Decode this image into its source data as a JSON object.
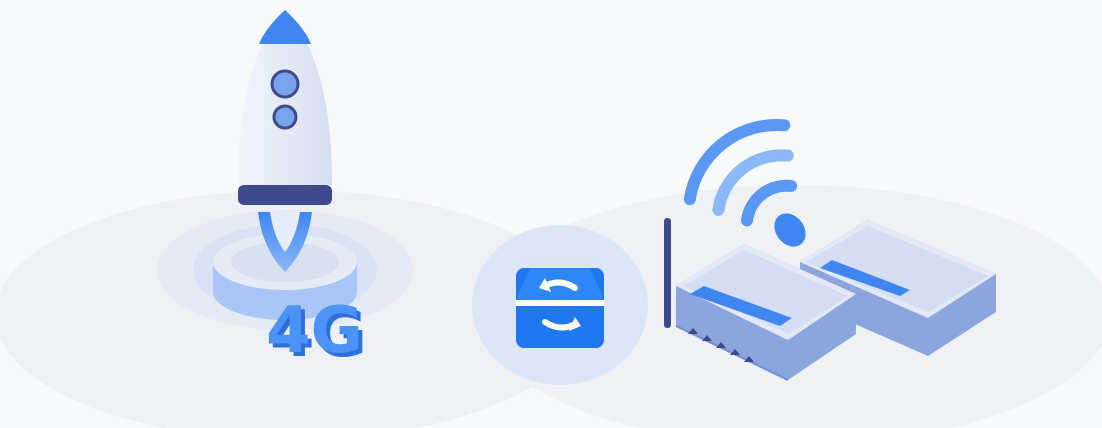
{
  "badge": {
    "text": "4G"
  },
  "colors": {
    "background": "#f8f9fb",
    "ellipse": "#eef0f4",
    "accent": "#3f86f0",
    "accent_light": "#8bb8f8",
    "rocket_body": "#e4e9f5",
    "rocket_band": "#3e4a8c",
    "router_top": "#dfe7f7",
    "router_side": "#8ca6dd",
    "sync_bg": "#1f78f0"
  },
  "icons": {
    "rocket": "rocket-icon",
    "network_4g": "network-4g-icon",
    "sync": "sync-box-icon",
    "router": "router-icon",
    "wifi": "wifi-signal-icon"
  }
}
